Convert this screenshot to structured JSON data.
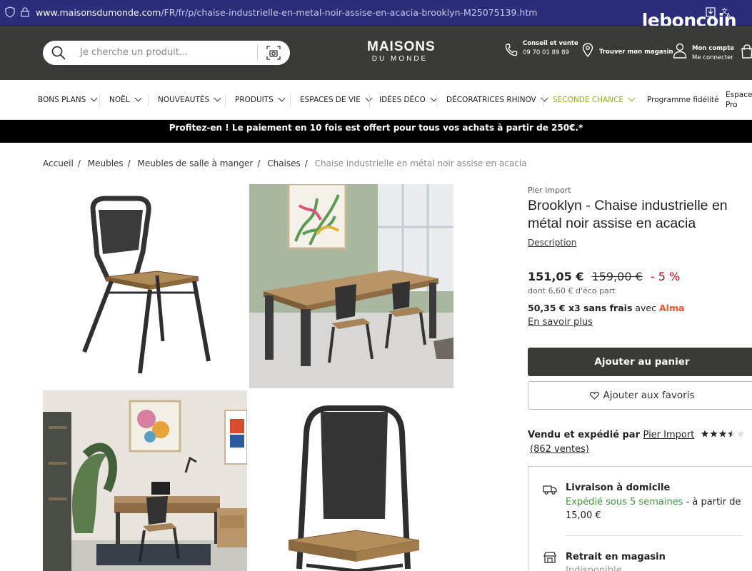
{
  "browser": {
    "url_domain": "www.maisonsdumonde.com",
    "url_path": "/FR/fr/p/chaise-industrielle-en-metal-noir-assise-en-acacia-brooklyn-M25075139.htm",
    "overlay_logo": "leboncoin"
  },
  "header": {
    "search_placeholder": "Je cherche un produit...",
    "logo_line1": "MAISONS",
    "logo_line2": "DU MONDE",
    "conseil_title": "Conseil et vente",
    "conseil_phone": "09 70 01 89 89",
    "store_label": "Trouver mon magasin",
    "account_title": "Mon compte",
    "account_sub": "Me connecter"
  },
  "nav": {
    "items": [
      "BONS PLANS",
      "NOËL",
      "NOUVEAUTÉS",
      "PRODUITS",
      "ESPACES DE VIE",
      "IDÉES DÉCO",
      "DÉCORATRICES RHINOV",
      "SECONDE CHANCE"
    ],
    "fidelite": "Programme fidélité",
    "pro_line1": "Espace",
    "pro_line2": "Pro"
  },
  "promo": "Profitez-en ! Le paiement en 10 fois est offert pour tous vos achats à partir de 250€.*",
  "breadcrumb": [
    "Accueil",
    "Meubles",
    "Meubles de salle à manger",
    "Chaises",
    "Chaise industrielle en métal noir assise en acacia"
  ],
  "product": {
    "brand": "Pier import",
    "title": "Brooklyn - Chaise industrielle en métal noir assise en acacia",
    "description_link": "Description",
    "price_now": "151,05 €",
    "price_old": "159,00 €",
    "discount": "- 5 %",
    "eco_part": "dont 6,60 € d'éco part",
    "installments": "50,35 € x3 sans frais",
    "installments_with": "avec",
    "installments_provider": "Alma",
    "learn_more": "En savoir plus",
    "add_to_cart": "Ajouter au panier",
    "add_to_favorites": "Ajouter aux favoris",
    "seller_prefix": "Vendu et expédié par",
    "seller_name": "Pier Import",
    "seller_rating": 3.5,
    "seller_rating_max": 5,
    "seller_sales": "(862 ventes)"
  },
  "delivery": {
    "home_title": "Livraison à domicile",
    "home_ship": "Expédié sous 5 semaines",
    "home_price": " - à partir de 15,00 €",
    "store_title": "Retrait en magasin",
    "store_status": "Indisponible"
  },
  "colors": {
    "header_bg": "#3a3a38",
    "promo_bg": "#000000",
    "discount": "#d0021b",
    "seconde_chance": "#8ab51f",
    "alma": "#fa5022",
    "shipping_green": "#3c9a3a"
  }
}
